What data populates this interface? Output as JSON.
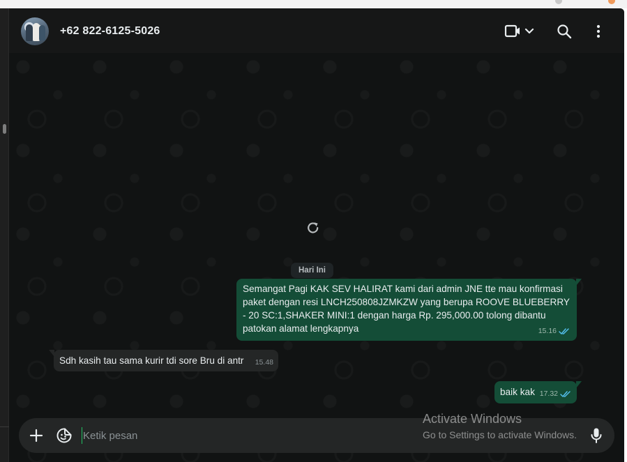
{
  "header": {
    "contact_name": "+62 822-6125-5026"
  },
  "chat": {
    "date_divider": "Hari Ini",
    "messages": [
      {
        "direction": "outgoing",
        "text": "Semangat Pagi KAK SEV HALIRAT kami dari admin JNE tte mau konfirmasi paket dengan resi LNCH250808JZMKZW yang berupa ROOVE BLUEBERRY - 20 SC:1,SHAKER MINI:1 dengan harga Rp. 295,000.00  tolong dibantu patokan alamat lengkapnya",
        "time": "15.16",
        "status": "read"
      },
      {
        "direction": "incoming",
        "text": "Sdh kasih tau sama kurir tdi sore Bru di antr",
        "time": "15.48"
      },
      {
        "direction": "outgoing",
        "text": "baik kak",
        "time": "17.32",
        "status": "read"
      }
    ]
  },
  "composer": {
    "placeholder": "Ketik pesan"
  },
  "watermark": {
    "title": "Activate Windows",
    "subtitle": "Go to Settings to activate Windows."
  },
  "colors": {
    "background": "#161717",
    "outgoing_bubble": "#144d37",
    "incoming_bubble": "#242626",
    "read_ticks": "#53bdeb",
    "accent": "#21c063"
  }
}
